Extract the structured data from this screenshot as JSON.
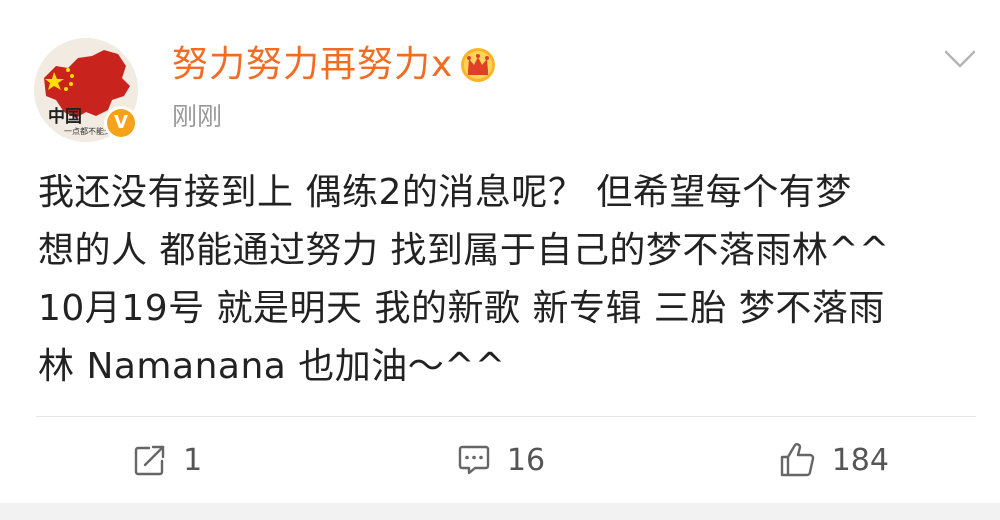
{
  "post": {
    "username": "努力努力再努力x",
    "timestamp": "刚刚",
    "avatar": {
      "text_main": "中国",
      "text_sub": "一点都不能少",
      "verified_glyph": "V"
    },
    "text_lines": [
      "我还没有接到上 偶练2的消息呢？ 但希望每个有梦",
      "想的人 都能通过努力 找到属于自己的梦不落雨林^^",
      "10月19号 就是明天 我的新歌 新专辑 三胎 梦不落雨",
      "林 Namanana 也加油～^^"
    ]
  },
  "actions": {
    "repost": {
      "count": "1",
      "icon": "share-icon"
    },
    "comment": {
      "count": "16",
      "icon": "comment-icon"
    },
    "like": {
      "count": "184",
      "icon": "thumbs-up-icon"
    }
  },
  "colors": {
    "username": "#f26c24",
    "verified": "#f7a21b",
    "text": "#222222",
    "muted": "#999999"
  }
}
